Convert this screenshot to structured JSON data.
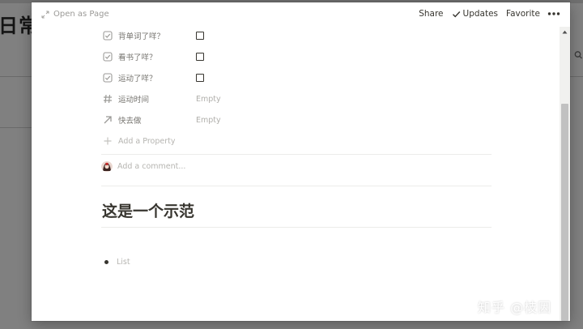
{
  "background": {
    "title": "日常"
  },
  "topbar": {
    "open_as_page": "Open as Page",
    "share": "Share",
    "updates": "Updates",
    "favorite": "Favorite"
  },
  "properties": [
    {
      "icon": "checkbox-property-icon",
      "name": "背单词了咩？",
      "type": "checkbox",
      "checked": false
    },
    {
      "icon": "checkbox-property-icon",
      "name": "看书了咩？",
      "type": "checkbox",
      "checked": false
    },
    {
      "icon": "checkbox-property-icon",
      "name": "运动了咩？",
      "type": "checkbox",
      "checked": false
    },
    {
      "icon": "number-property-icon",
      "name": "运动时间",
      "type": "number",
      "value": "Empty"
    },
    {
      "icon": "arrow-up-right-icon",
      "name": "快去做",
      "type": "relation",
      "value": "Empty"
    }
  ],
  "add_property": "Add a Property",
  "comment": {
    "placeholder": "Add a comment..."
  },
  "body": {
    "heading": "这是一个示范",
    "list_placeholder": "List"
  },
  "watermark": "知乎 @枝因",
  "colors": {
    "text": "#37352f",
    "muted": "#9b9a97",
    "overlay": "#808080"
  }
}
